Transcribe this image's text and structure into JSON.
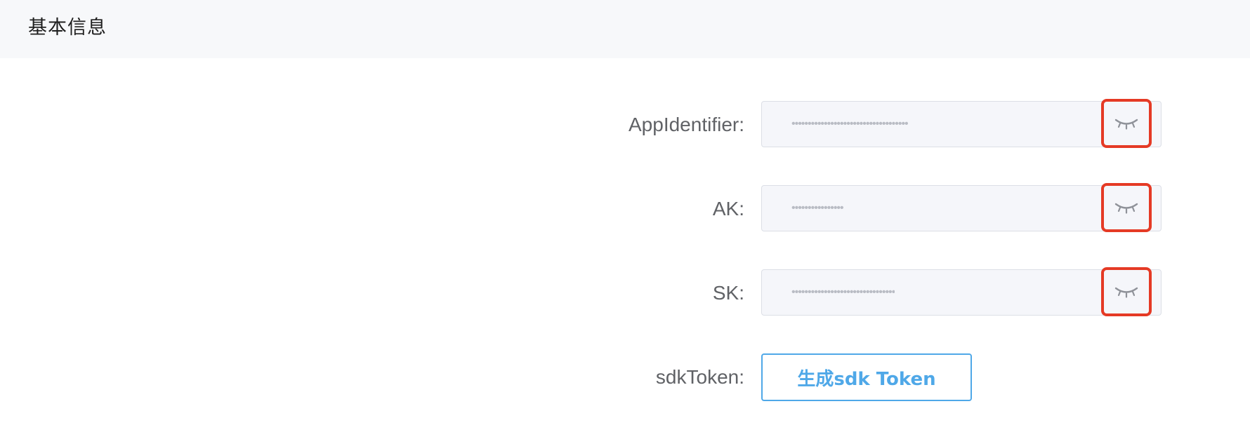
{
  "section": {
    "title": "基本信息"
  },
  "fields": [
    {
      "label": "AppIdentifier:",
      "masked_value": "••••••••••••••••••••••••••••••••••••",
      "toggle_icon": "eye-closed-icon"
    },
    {
      "label": "AK:",
      "masked_value": "••••••••••••••••",
      "toggle_icon": "eye-closed-icon"
    },
    {
      "label": "SK:",
      "masked_value": "••••••••••••••••••••••••••••••••",
      "toggle_icon": "eye-closed-icon"
    }
  ],
  "sdk_token": {
    "label": "sdkToken:",
    "button_label": "生成sdk Token"
  },
  "colors": {
    "header_bg": "#f7f8fa",
    "field_bg": "#f5f6fa",
    "highlight": "#e53a25",
    "accent": "#4fa8e8"
  }
}
